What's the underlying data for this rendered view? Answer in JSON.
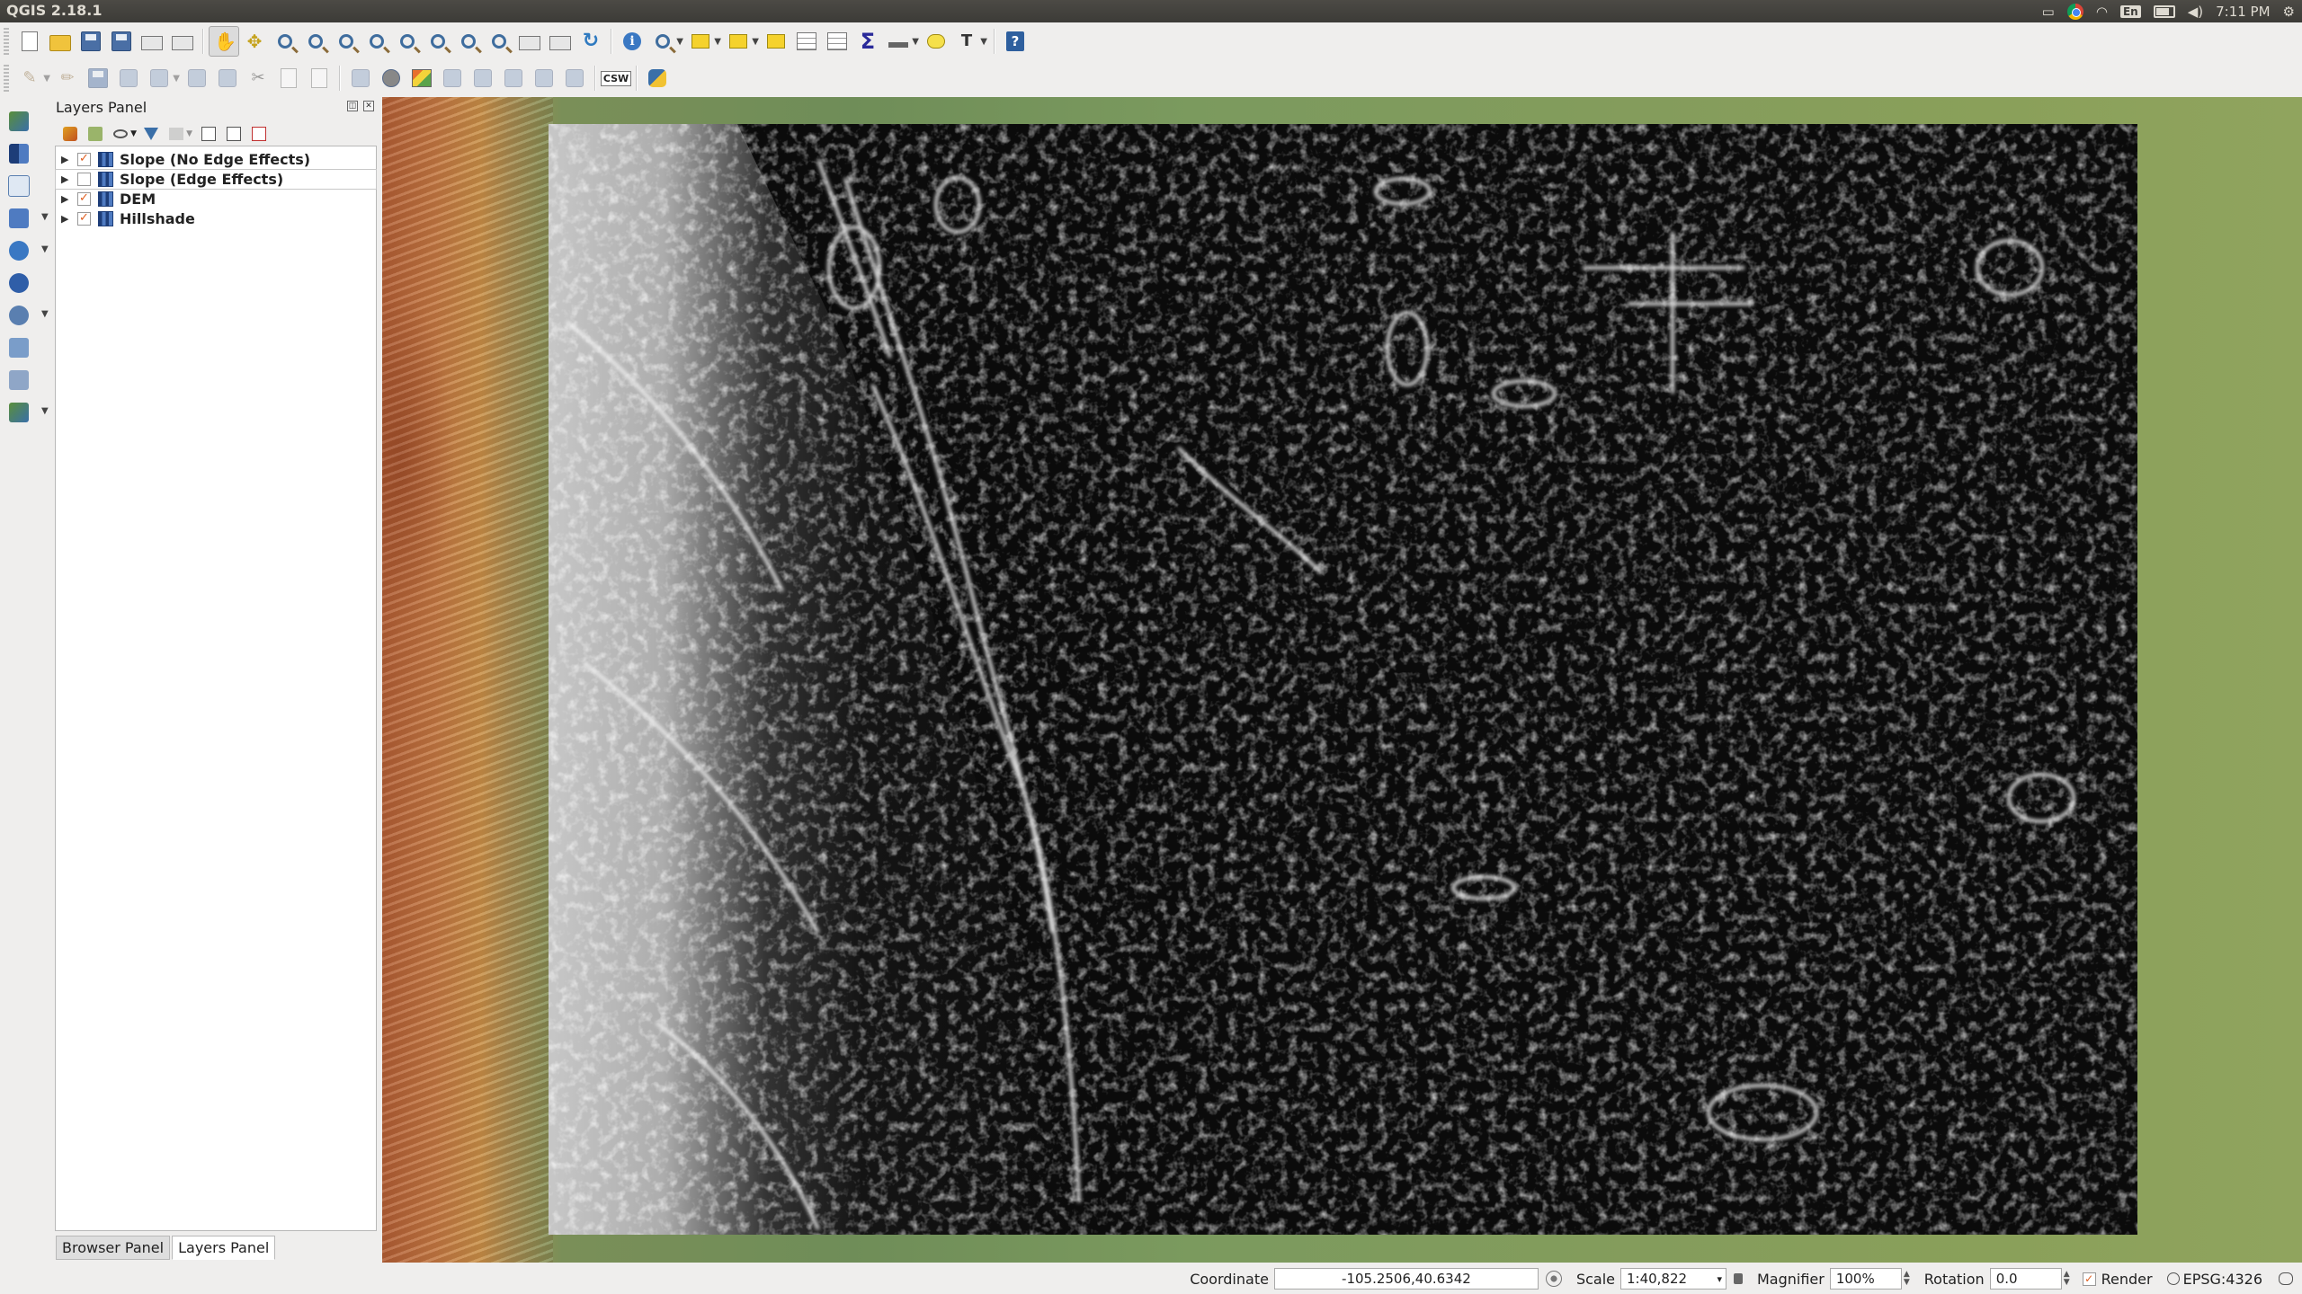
{
  "window": {
    "title": "QGIS 2.18.1"
  },
  "system_tray": {
    "keyboard": "En",
    "time": "7:11 PM"
  },
  "layers_panel": {
    "title": "Layers Panel",
    "layers": [
      {
        "name": "Slope (No Edge Effects)",
        "checked": true
      },
      {
        "name": "Slope (Edge Effects)",
        "checked": false
      },
      {
        "name": "DEM",
        "checked": true
      },
      {
        "name": "Hillshade",
        "checked": true
      }
    ]
  },
  "panel_tabs": {
    "browser": "Browser Panel",
    "layers": "Layers Panel"
  },
  "toolbar2": {
    "csw_label": "CSW"
  },
  "status_bar": {
    "coordinate_label": "Coordinate",
    "coordinate_value": "-105.2506,40.6342",
    "scale_label": "Scale",
    "scale_value": "1:40,822",
    "magnifier_label": "Magnifier",
    "magnifier_value": "100%",
    "rotation_label": "Rotation",
    "rotation_value": "0.0",
    "render_label": "Render",
    "render_checked": true,
    "crs": "EPSG:4326"
  },
  "colors": {
    "accent_check": "#e05e1f",
    "layer_icon": "#2f5ea8",
    "dem_low": "#b25f36",
    "dem_high": "#8aa05a",
    "slope_background": "#0b0b0b"
  }
}
